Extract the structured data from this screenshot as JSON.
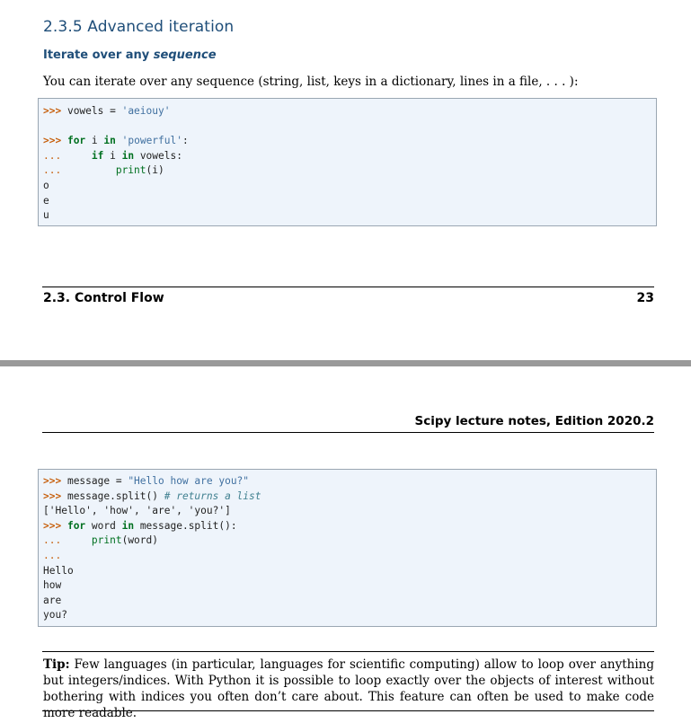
{
  "section": {
    "number": "2.3.5",
    "title": "Advanced iteration"
  },
  "subsection": {
    "title_plain": "Iterate over any ",
    "title_emph": "sequence"
  },
  "intro_text": "You can iterate over any sequence (string, list, keys in a dictionary, lines in a file, . . . ):",
  "code_block_1": {
    "lines": [
      [
        {
          "t": ">>> ",
          "c": "prompt"
        },
        {
          "t": "vowels = ",
          "c": ""
        },
        {
          "t": "'aeiouy'",
          "c": "str"
        }
      ],
      [
        {
          "t": "",
          "c": ""
        }
      ],
      [
        {
          "t": ">>> ",
          "c": "prompt"
        },
        {
          "t": "for",
          "c": "kw"
        },
        {
          "t": " i ",
          "c": ""
        },
        {
          "t": "in",
          "c": "kw"
        },
        {
          "t": " ",
          "c": ""
        },
        {
          "t": "'powerful'",
          "c": "str"
        },
        {
          "t": ":",
          "c": ""
        }
      ],
      [
        {
          "t": "...     ",
          "c": "cont"
        },
        {
          "t": "if",
          "c": "kw"
        },
        {
          "t": " i ",
          "c": ""
        },
        {
          "t": "in",
          "c": "kw"
        },
        {
          "t": " vowels:",
          "c": ""
        }
      ],
      [
        {
          "t": "...         ",
          "c": "cont"
        },
        {
          "t": "print",
          "c": "builtin"
        },
        {
          "t": "(i)",
          "c": ""
        }
      ],
      [
        {
          "t": "o",
          "c": ""
        }
      ],
      [
        {
          "t": "e",
          "c": ""
        }
      ],
      [
        {
          "t": "u",
          "c": ""
        }
      ]
    ]
  },
  "footer": {
    "left": "2.3.  Control Flow",
    "page_number": "23"
  },
  "header": {
    "right": "Scipy lecture notes, Edition 2020.2"
  },
  "code_block_2": {
    "lines": [
      [
        {
          "t": ">>> ",
          "c": "prompt"
        },
        {
          "t": "message = ",
          "c": ""
        },
        {
          "t": "\"Hello how are you?\"",
          "c": "str"
        }
      ],
      [
        {
          "t": ">>> ",
          "c": "prompt"
        },
        {
          "t": "message.split() ",
          "c": ""
        },
        {
          "t": "# returns a list",
          "c": "comment"
        }
      ],
      [
        {
          "t": "['Hello', 'how', 'are', 'you?']",
          "c": ""
        }
      ],
      [
        {
          "t": ">>> ",
          "c": "prompt"
        },
        {
          "t": "for",
          "c": "kw"
        },
        {
          "t": " word ",
          "c": ""
        },
        {
          "t": "in",
          "c": "kw"
        },
        {
          "t": " message.split():",
          "c": ""
        }
      ],
      [
        {
          "t": "...     ",
          "c": "cont"
        },
        {
          "t": "print",
          "c": "builtin"
        },
        {
          "t": "(word)",
          "c": ""
        }
      ],
      [
        {
          "t": "...",
          "c": "cont"
        }
      ],
      [
        {
          "t": "Hello",
          "c": ""
        }
      ],
      [
        {
          "t": "how",
          "c": ""
        }
      ],
      [
        {
          "t": "are",
          "c": ""
        }
      ],
      [
        {
          "t": "you?",
          "c": ""
        }
      ]
    ]
  },
  "tip": {
    "label": "Tip:",
    "text": "Few languages (in particular, languages for scientific computing) allow to loop over anything but integers/indices. With Python it is possible to loop exactly over the objects of interest without bothering with indices you often don’t care about. This feature can often be used to make code more readable."
  }
}
